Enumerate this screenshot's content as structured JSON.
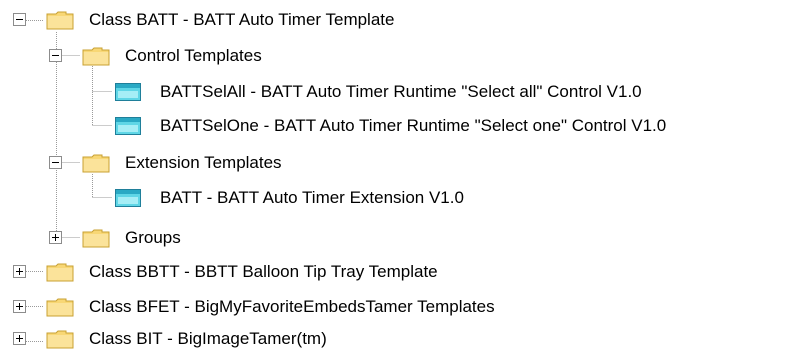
{
  "tree": {
    "nodes": [
      {
        "label": "Class BATT - BATT Auto Timer Template",
        "kind": "folder",
        "state": "expanded",
        "depth": 0
      },
      {
        "label": "Control Templates",
        "kind": "folder",
        "state": "expanded",
        "depth": 1
      },
      {
        "label": "BATTSelAll - BATT Auto Timer Runtime \"Select all\" Control V1.0",
        "kind": "template",
        "state": "leaf",
        "depth": 2
      },
      {
        "label": "BATTSelOne - BATT Auto Timer Runtime \"Select one\" Control V1.0",
        "kind": "template",
        "state": "leaf",
        "depth": 2
      },
      {
        "label": "Extension Templates",
        "kind": "folder",
        "state": "expanded",
        "depth": 1
      },
      {
        "label": "BATT - BATT Auto Timer Extension V1.0",
        "kind": "template",
        "state": "leaf",
        "depth": 2
      },
      {
        "label": "Groups",
        "kind": "folder",
        "state": "collapsed",
        "depth": 1
      },
      {
        "label": "Class BBTT - BBTT Balloon Tip Tray Template",
        "kind": "folder",
        "state": "collapsed",
        "depth": 0
      },
      {
        "label": "Class BFET - BigMyFavoriteEmbedsTamer Templates",
        "kind": "folder",
        "state": "collapsed",
        "depth": 0
      },
      {
        "label": "Class BIT - BigImageTamer(tm)",
        "kind": "folder",
        "state": "collapsed",
        "depth": 0
      }
    ]
  },
  "icons": {
    "folder": "folder-icon",
    "template": "template-icon",
    "expand": "plus-box-icon",
    "collapse": "minus-box-icon"
  },
  "colors": {
    "folder_fill": "#f8d775",
    "folder_edge": "#c8a032",
    "template_fill": "#5fd6e6",
    "template_edge": "#1f7f9a",
    "tree_line": "#9a9a9a",
    "text": "#000000"
  }
}
